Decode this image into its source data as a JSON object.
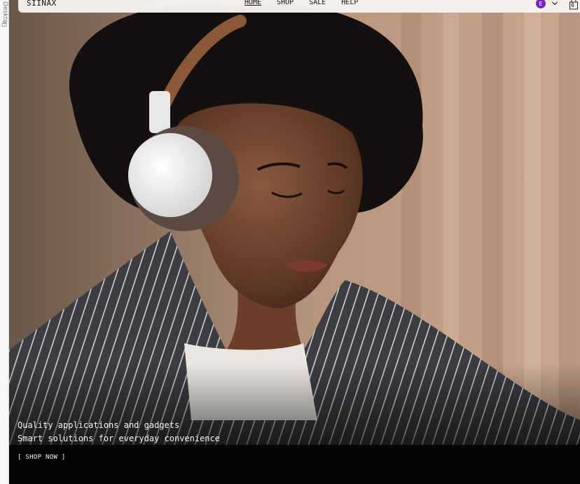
{
  "editor": {
    "side_label": "Deskto"
  },
  "header": {
    "logo": "SIINAX",
    "nav": [
      {
        "label": "HOME",
        "active": true
      },
      {
        "label": "SHOP",
        "active": false
      },
      {
        "label": "SALE",
        "active": false
      },
      {
        "label": "HELP",
        "active": false
      }
    ],
    "avatar_initial": "E",
    "cart_count": "0"
  },
  "hero": {
    "title": "Quality applications and gadgets",
    "subtitle": "Smart solutions for everyday convenience",
    "cta_label": "[ SHOP NOW ]",
    "image_subject": "woman-with-headphones-photo"
  },
  "colors": {
    "avatar_bg": "#7a22c2",
    "header_bg": "#f5f2ee",
    "band_bg": "#050505"
  }
}
